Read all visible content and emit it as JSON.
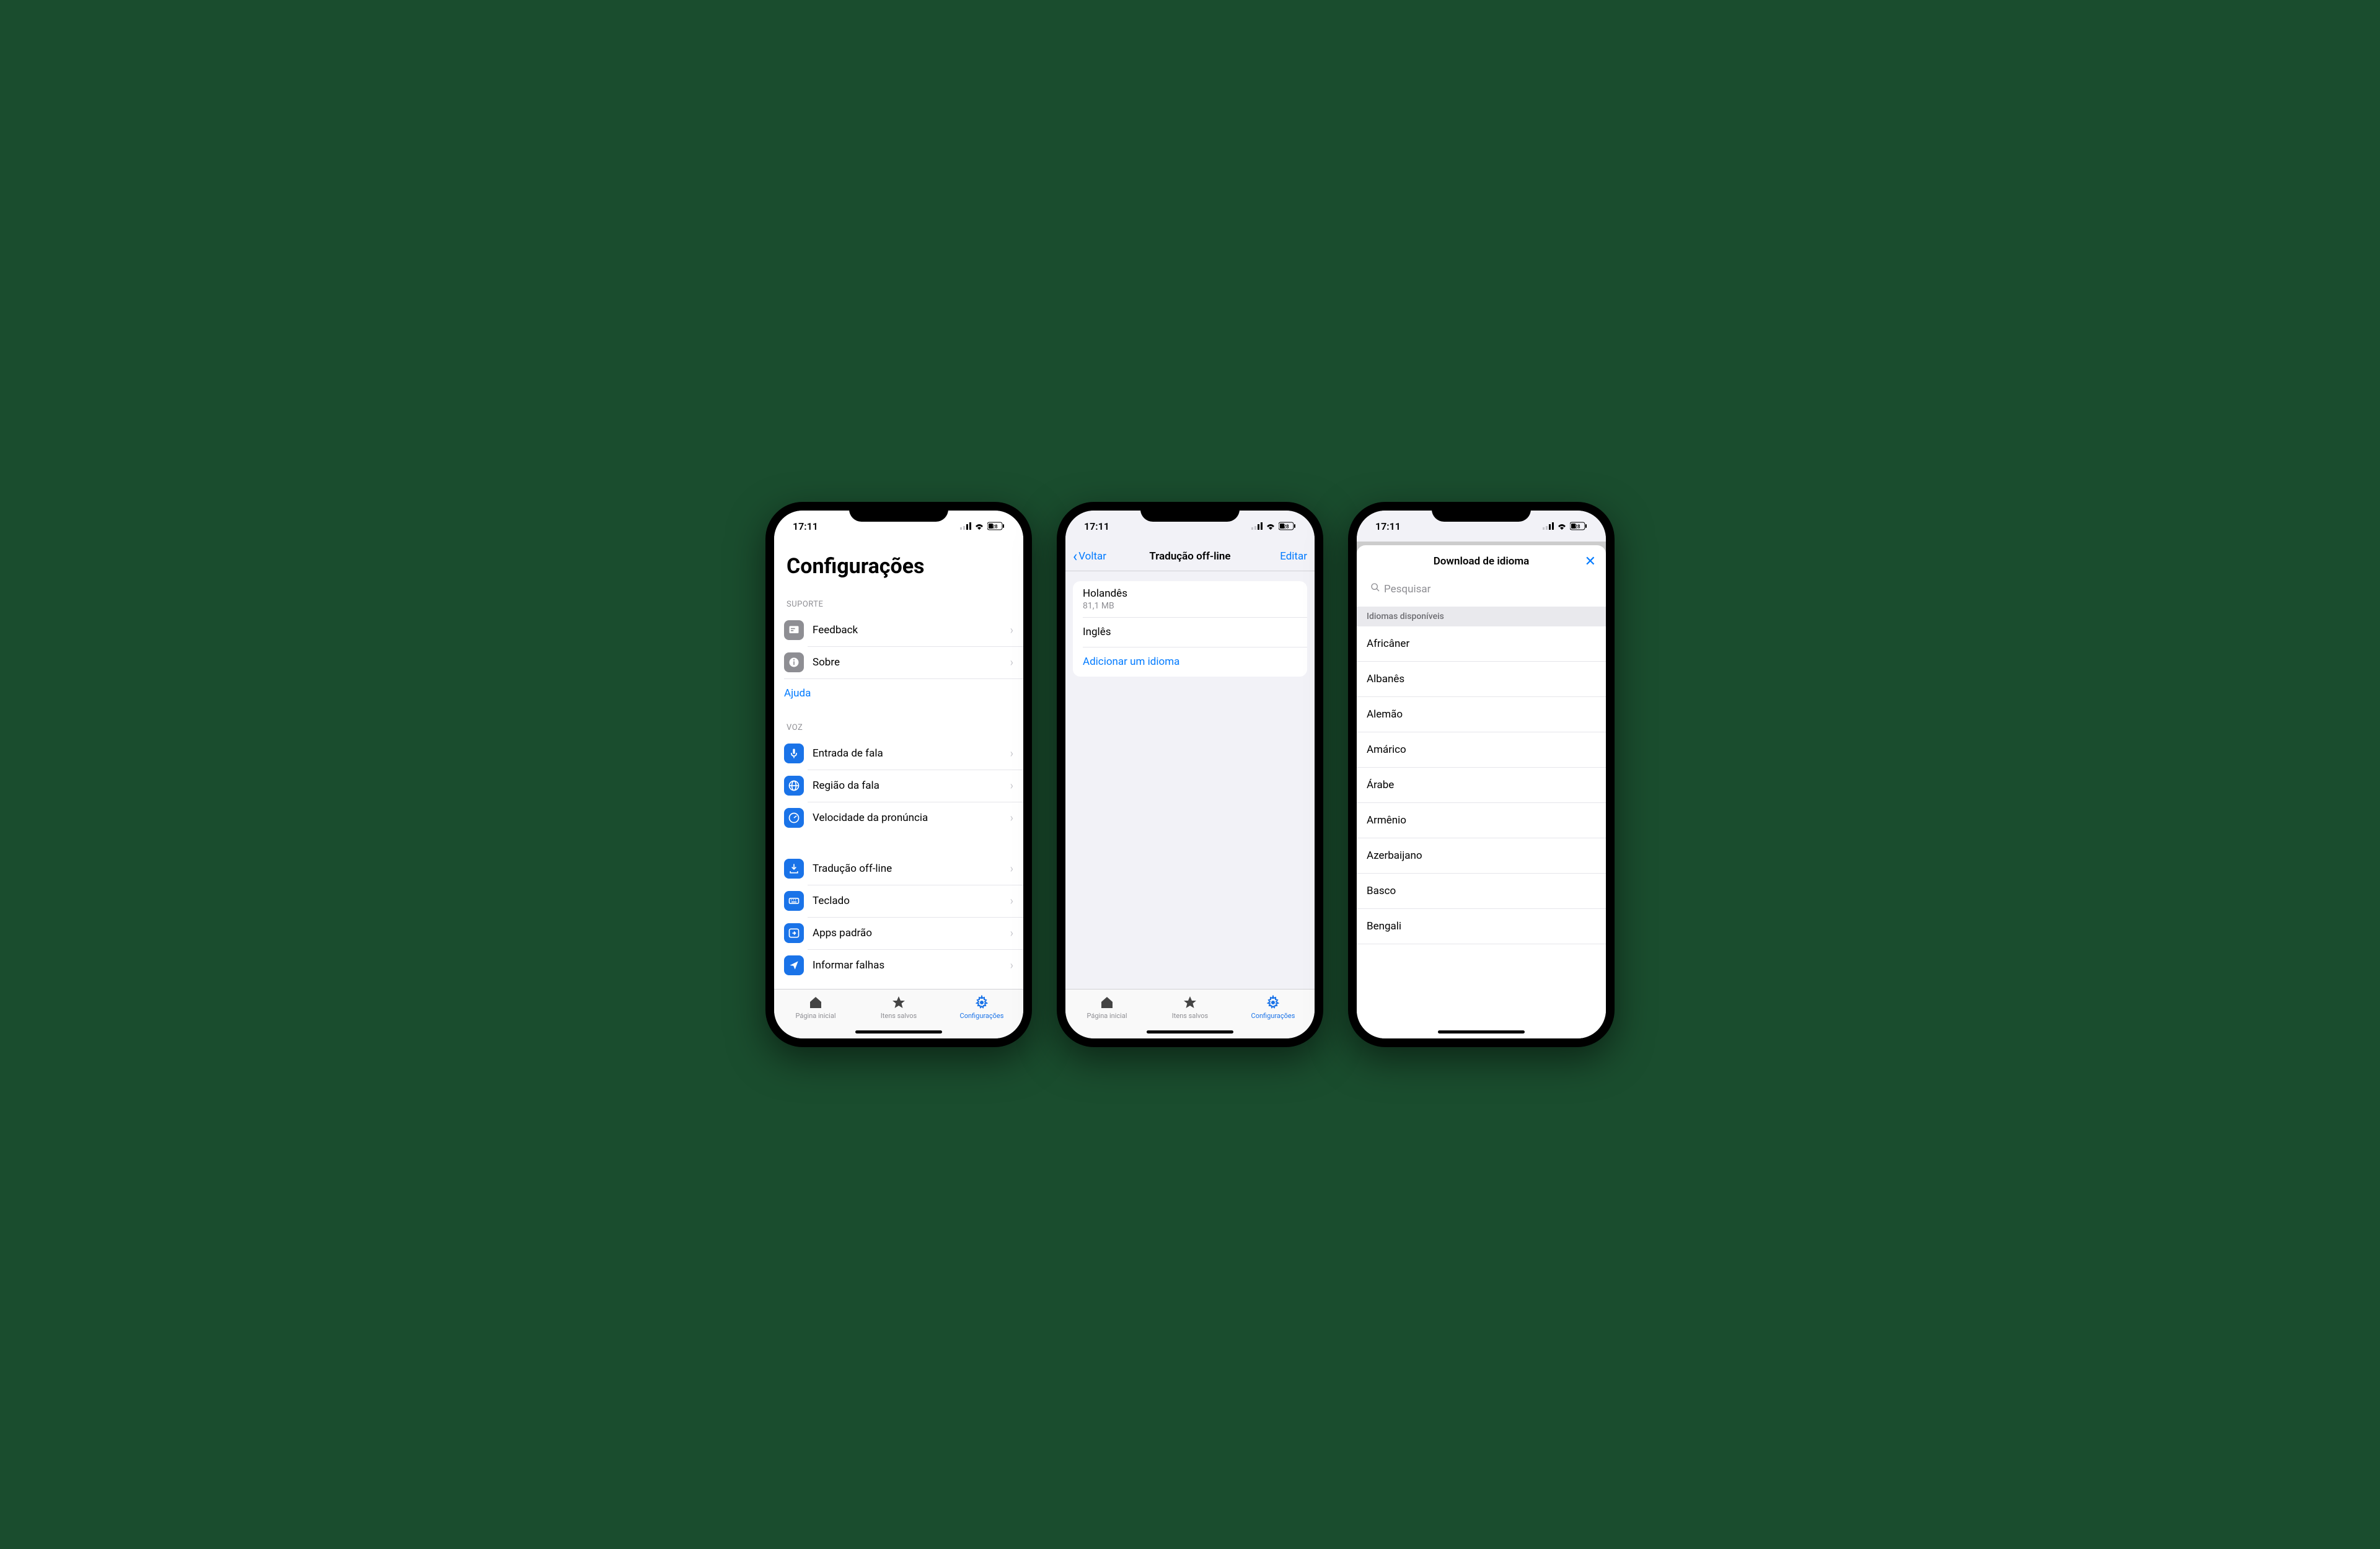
{
  "status": {
    "time": "17:11",
    "battery": "28"
  },
  "screen1": {
    "title": "Configurações",
    "sections": {
      "support": {
        "header": "SUPORTE",
        "feedback": "Feedback",
        "about": "Sobre",
        "help": "Ajuda"
      },
      "voice": {
        "header": "VOZ",
        "speech_input": "Entrada de fala",
        "speech_region": "Região da fala",
        "speech_speed": "Velocidade da pronúncia"
      },
      "general": {
        "offline": "Tradução off-line",
        "keyboard": "Teclado",
        "default_apps": "Apps padrão",
        "report": "Informar falhas"
      }
    }
  },
  "screen2": {
    "back": "Voltar",
    "title": "Tradução off-line",
    "edit": "Editar",
    "lang1": {
      "name": "Holandês",
      "size": "81,1 MB"
    },
    "lang2": {
      "name": "Inglês"
    },
    "add": "Adicionar um idioma"
  },
  "screen3": {
    "title": "Download de idioma",
    "search_placeholder": "Pesquisar",
    "section_header": "Idiomas disponíveis",
    "languages": [
      "Africâner",
      "Albanês",
      "Alemão",
      "Amárico",
      "Árabe",
      "Armênio",
      "Azerbaijano",
      "Basco",
      "Bengali"
    ]
  },
  "tabs": {
    "home": "Página inicial",
    "saved": "Itens salvos",
    "settings": "Configurações"
  }
}
